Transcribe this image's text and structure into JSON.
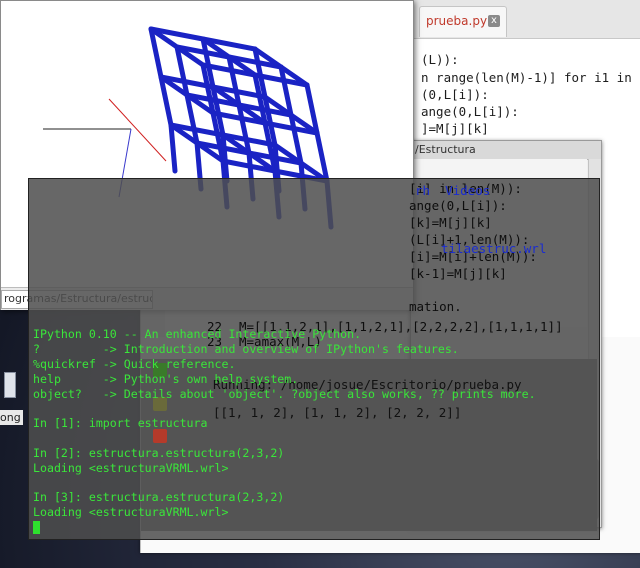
{
  "editor": {
    "tab_label": "prueba.py",
    "tab_close": "x",
    "code": [
      "(L)):",
      "n range(len(M)-1)] for i1 in",
      "(0,L[i]):",
      "ange(0,L[i]):",
      "]=M[j][k]",
      "(0,L[i]):"
    ]
  },
  "output_panel": {
    "title": "/Estructura",
    "lines_top": [
      "[i] in len(M)):",
      "ange(0,L[i]):",
      "[k]=M[j][k]",
      "(L[i]+1,len(M)):",
      "[i]=M[i]+len(M)):",
      "[k-1]=M[j][k]"
    ],
    "info_text": "mation.",
    "code_numbered": [
      {
        "num": "22",
        "text": "M=[[1,1,2,1],[1,1,2,1],[2,2,2,2],[1,1,1,1]]"
      },
      {
        "num": "23",
        "text": "M=amax(M,L)"
      }
    ],
    "run_label": "Running: /home/josue/Escritorio/prueba.py",
    "run_result": "[[1, 1, 2], [1, 1, 2], [2, 2, 2]]"
  },
  "viewer": {
    "path_text": "rogramas/Estructura/estruct",
    "frame_color": "#1a23c4"
  },
  "desktop": {
    "icon_label": "ong"
  },
  "terminal": {
    "lines": [
      "IPython 0.10 -- An enhanced Interactive Python.",
      "?         -> Introduction and overview of IPython's features.",
      "%quickref -> Quick reference.",
      "help      -> Python's own help system.",
      "object?   -> Details about 'object'. ?object also works, ?? prints more.",
      "",
      "In [1]: import estructura",
      "",
      "In [2]: estructura.estructura(2,3,2)",
      "Loading <estructuraVRML.wrl>",
      "",
      "In [3]: estructura.estructura(2,3,2)",
      "Loading <estructuraVRML.wrl>"
    ],
    "ghost_texts": [
      "rh  Videos",
      "tilaestruc.wrl"
    ]
  }
}
